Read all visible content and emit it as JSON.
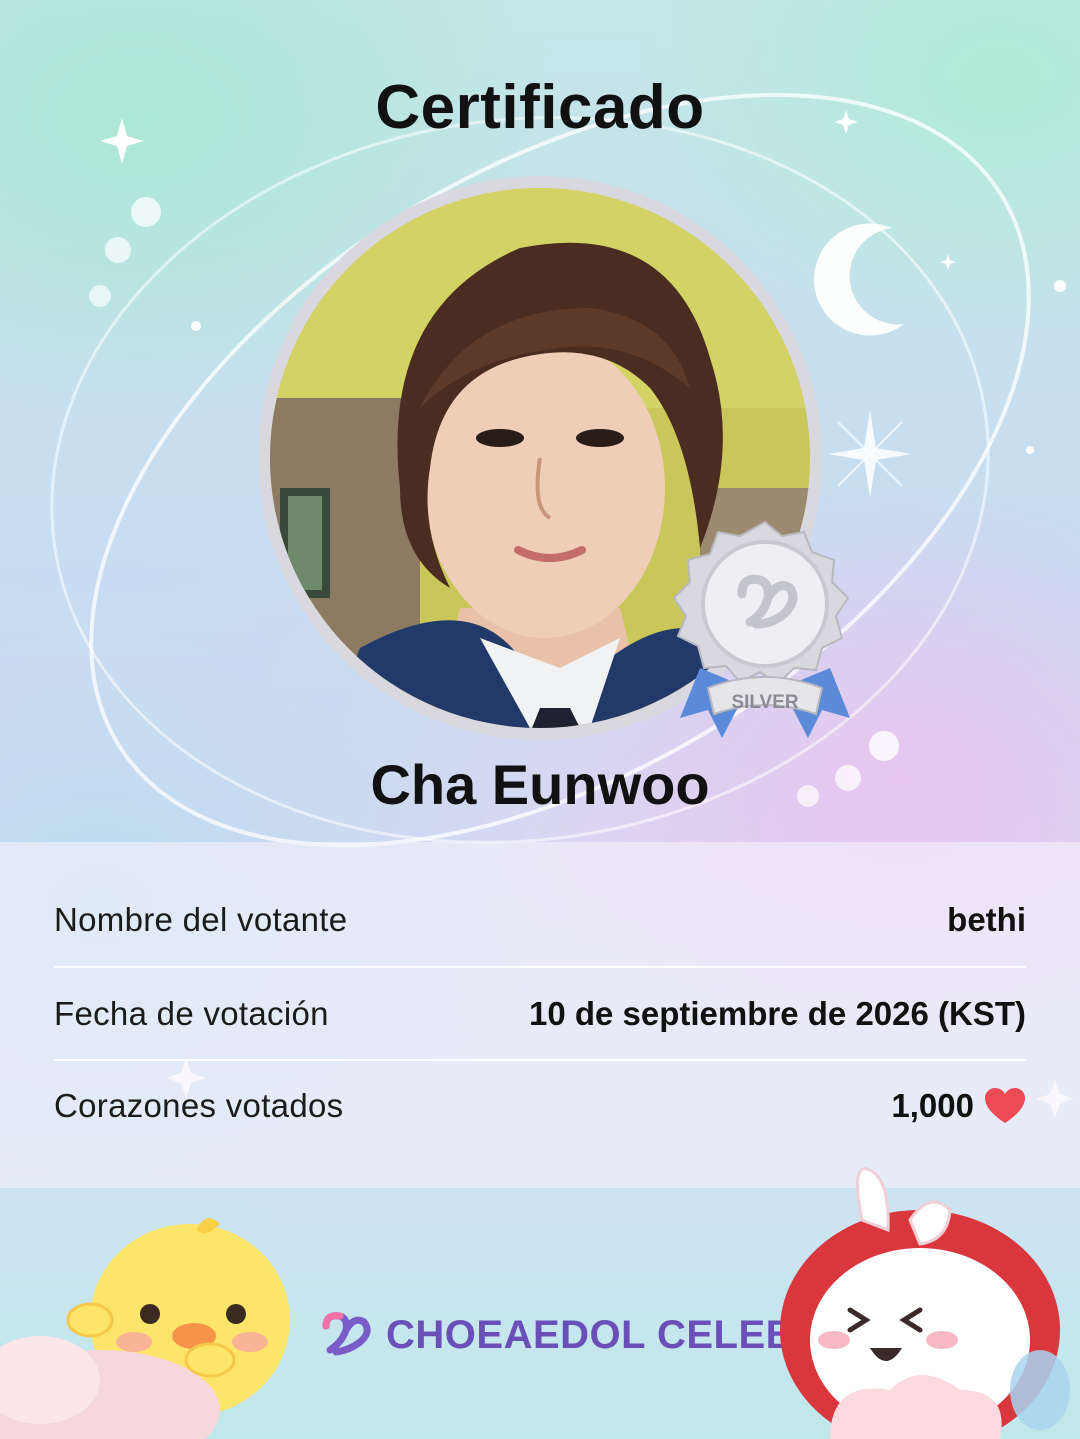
{
  "certificate": {
    "title": "Certificado",
    "celebrity_name": "Cha Eunwoo",
    "badge_tier": "SILVER"
  },
  "info": {
    "rows": [
      {
        "label": "Nombre del votante",
        "value": "bethi"
      },
      {
        "label": "Fecha de votación",
        "value": "10 de septiembre de 2026 (KST)"
      },
      {
        "label": "Corazones votados",
        "value": "1,000"
      }
    ],
    "heart_icon": "heart-icon",
    "heart_color": "#ec4a55"
  },
  "brand": {
    "logo_text": "CHOEAEDOL CELEB",
    "logo_color": "#6a4fb8"
  },
  "decorations": [
    "moon-icon",
    "sparkle-icon",
    "orbit-ring",
    "chick-mascot",
    "bunny-mascot"
  ]
}
